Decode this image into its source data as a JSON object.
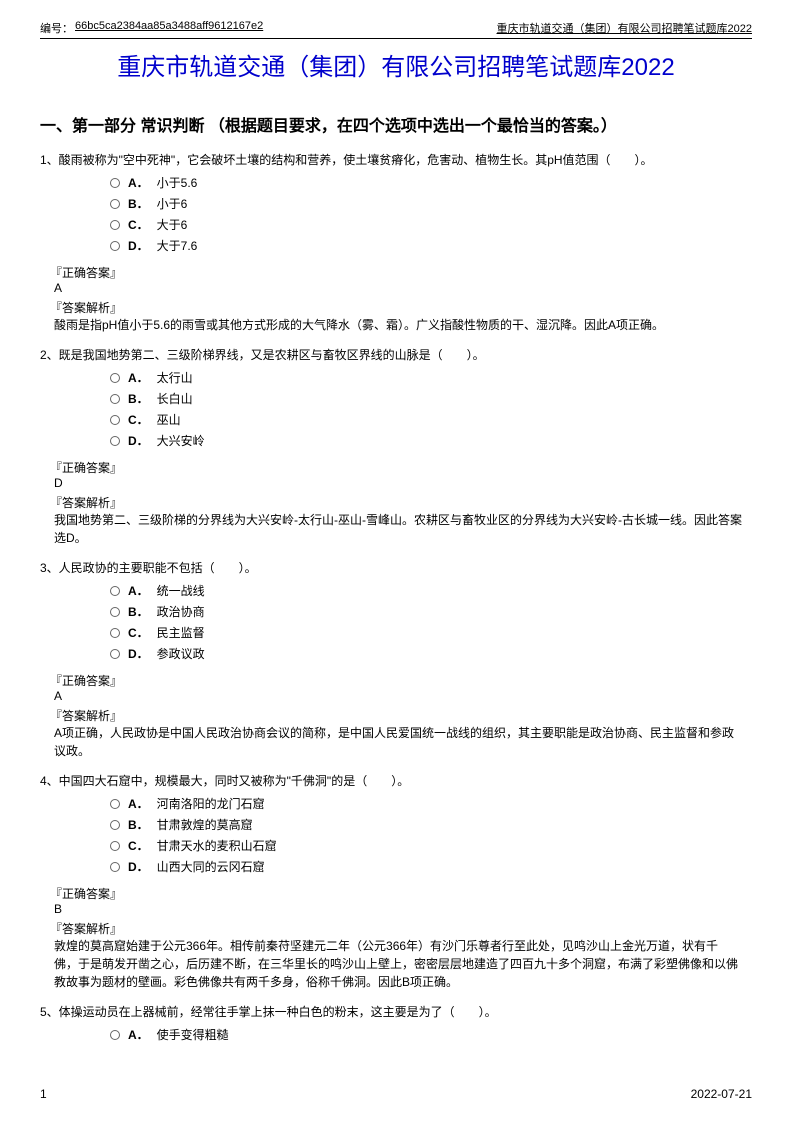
{
  "header": {
    "id_label": "编号：",
    "id_value": "66bc5ca2384aa85a3488aff9612167e2",
    "right_text": "重庆市轨道交通（集团）有限公司招聘笔试题库2022"
  },
  "title": "重庆市轨道交通（集团）有限公司招聘笔试题库2022",
  "section_title": "一、第一部分 常识判断 （根据题目要求，在四个选项中选出一个最恰当的答案。）",
  "questions": [
    {
      "number": "1、",
      "text": "酸雨被称为\"空中死神\"，它会破坏土壤的结构和营养，使土壤贫瘠化，危害动、植物生长。其pH值范围（　　）。",
      "options": [
        {
          "letter": "A．",
          "text": "小于5.6"
        },
        {
          "letter": "B．",
          "text": "小于6"
        },
        {
          "letter": "C．",
          "text": "大于6"
        },
        {
          "letter": "D．",
          "text": "大于7.6"
        }
      ],
      "answer_label": "『正确答案』",
      "answer": "A",
      "analysis_label": "『答案解析』",
      "analysis": "酸雨是指pH值小于5.6的雨雪或其他方式形成的大气降水（雾、霜）。广义指酸性物质的干、湿沉降。因此A项正确。"
    },
    {
      "number": "2、",
      "text": "既是我国地势第二、三级阶梯界线，又是农耕区与畜牧区界线的山脉是（　　）。",
      "options": [
        {
          "letter": "A．",
          "text": "太行山"
        },
        {
          "letter": "B．",
          "text": "长白山"
        },
        {
          "letter": "C．",
          "text": "巫山"
        },
        {
          "letter": "D．",
          "text": "大兴安岭"
        }
      ],
      "answer_label": "『正确答案』",
      "answer": "D",
      "analysis_label": "『答案解析』",
      "analysis": "我国地势第二、三级阶梯的分界线为大兴安岭-太行山-巫山-雪峰山。农耕区与畜牧业区的分界线为大兴安岭-古长城一线。因此答案选D。"
    },
    {
      "number": "3、",
      "text": "人民政协的主要职能不包括（　　）。",
      "options": [
        {
          "letter": "A．",
          "text": "统一战线"
        },
        {
          "letter": "B．",
          "text": "政治协商"
        },
        {
          "letter": "C．",
          "text": "民主监督"
        },
        {
          "letter": "D．",
          "text": "参政议政"
        }
      ],
      "answer_label": "『正确答案』",
      "answer": "A",
      "analysis_label": "『答案解析』",
      "analysis": "A项正确，人民政协是中国人民政治协商会议的简称，是中国人民爱国统一战线的组织，其主要职能是政治协商、民主监督和参政议政。"
    },
    {
      "number": "4、",
      "text": "中国四大石窟中，规模最大，同时又被称为\"千佛洞\"的是（　　）。",
      "options": [
        {
          "letter": "A．",
          "text": "河南洛阳的龙门石窟"
        },
        {
          "letter": "B．",
          "text": "甘肃敦煌的莫高窟"
        },
        {
          "letter": "C．",
          "text": "甘肃天水的麦积山石窟"
        },
        {
          "letter": "D．",
          "text": "山西大同的云冈石窟"
        }
      ],
      "answer_label": "『正确答案』",
      "answer": "B",
      "analysis_label": "『答案解析』",
      "analysis": "敦煌的莫高窟始建于公元366年。相传前秦苻坚建元二年（公元366年）有沙门乐尊者行至此处，见鸣沙山上金光万道，状有千佛，于是萌发开凿之心，后历建不断，在三华里长的鸣沙山上壁上，密密层层地建造了四百九十多个洞窟，布满了彩塑佛像和以佛教故事为题材的壁画。彩色佛像共有两千多身，俗称千佛洞。因此B项正确。"
    },
    {
      "number": "5、",
      "text": "体操运动员在上器械前，经常往手掌上抹一种白色的粉末，这主要是为了（　　）。",
      "options": [
        {
          "letter": "A．",
          "text": "使手变得粗糙"
        }
      ]
    }
  ],
  "footer": {
    "page": "1",
    "date": "2022-07-21"
  }
}
